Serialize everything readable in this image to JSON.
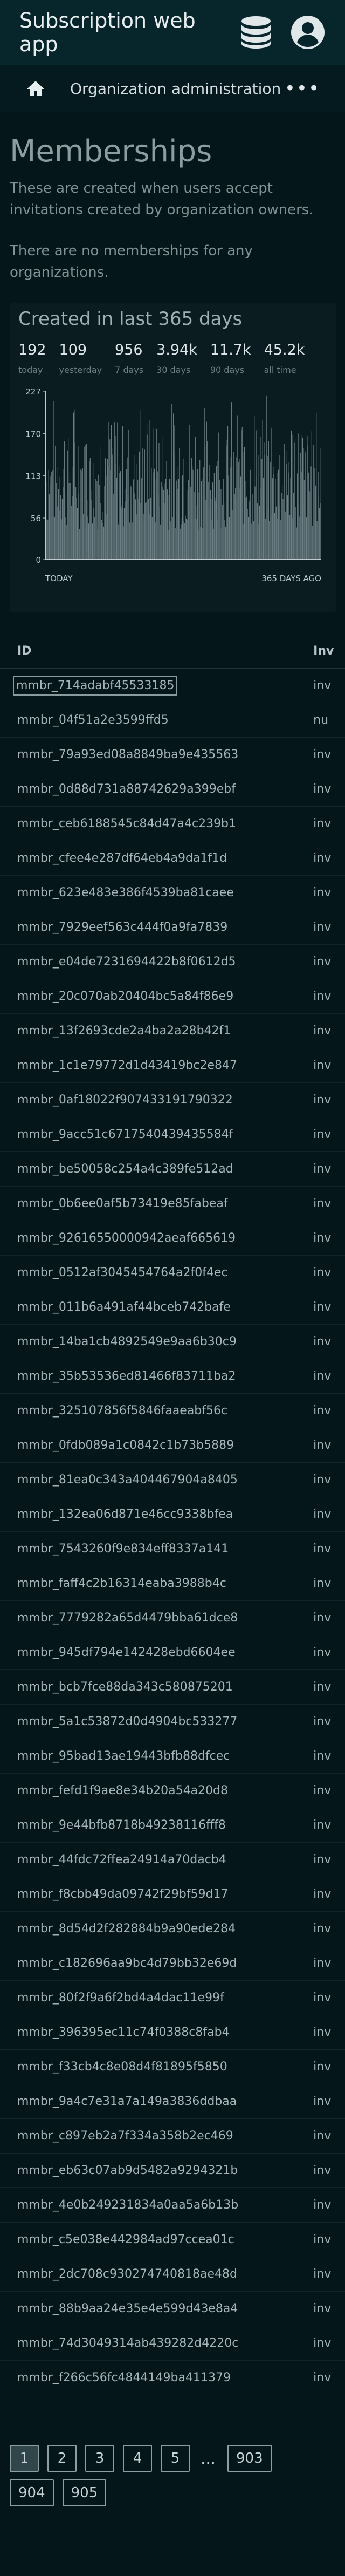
{
  "app": {
    "title": "Subscription web app"
  },
  "nav": {
    "title": "Organization administration",
    "more": "•••"
  },
  "page": {
    "title": "Memberships",
    "description": "These are created when users accept invitations created by organization owners.",
    "empty_text": "There are no memberships for any organizations."
  },
  "stats": {
    "title": "Created in last 365 days",
    "items": [
      {
        "value": "192",
        "label": "today"
      },
      {
        "value": "109",
        "label": "yesterday"
      },
      {
        "value": "956",
        "label": "7 days"
      },
      {
        "value": "3.94k",
        "label": "30 days"
      },
      {
        "value": "11.7k",
        "label": "90 days"
      },
      {
        "value": "45.2k",
        "label": "all time"
      }
    ]
  },
  "chart_data": {
    "type": "bar",
    "title": "",
    "xlabel": "",
    "ylabel": "",
    "ylim": [
      0,
      227
    ],
    "y_ticks": [
      "227",
      "170",
      "113",
      "56",
      "0"
    ],
    "x_tick_labels": [
      "TODAY",
      "365 DAYS AGO"
    ],
    "bar_count": 365,
    "bar_color": "#6d8085",
    "axis_color": "#c0ccce"
  },
  "table": {
    "columns": [
      "ID",
      "Inv"
    ],
    "rows": [
      [
        "mmbr_714adabf45533185",
        "inv"
      ],
      [
        "mmbr_04f51a2e3599ffd5",
        "nu"
      ],
      [
        "mmbr_79a93ed08a8849ba9e435563",
        "inv"
      ],
      [
        "mmbr_0d88d731a88742629a399ebf",
        "inv"
      ],
      [
        "mmbr_ceb6188545c84d47a4c239b1",
        "inv"
      ],
      [
        "mmbr_cfee4e287df64eb4a9da1f1d",
        "inv"
      ],
      [
        "mmbr_623e483e386f4539ba81caee",
        "inv"
      ],
      [
        "mmbr_7929eef563c444f0a9fa7839",
        "inv"
      ],
      [
        "mmbr_e04de7231694422b8f0612d5",
        "inv"
      ],
      [
        "mmbr_20c070ab20404bc5a84f86e9",
        "inv"
      ],
      [
        "mmbr_13f2693cde2a4ba2a28b42f1",
        "inv"
      ],
      [
        "mmbr_1c1e79772d1d43419bc2e847",
        "inv"
      ],
      [
        "mmbr_0af18022f907433191790322",
        "inv"
      ],
      [
        "mmbr_9acc51c6717540439435584f",
        "inv"
      ],
      [
        "mmbr_be50058c254a4c389fe512ad",
        "inv"
      ],
      [
        "mmbr_0b6ee0af5b73419e85fabeaf",
        "inv"
      ],
      [
        "mmbr_92616550000942aeaf665619",
        "inv"
      ],
      [
        "mmbr_0512af3045454764a2f0f4ec",
        "inv"
      ],
      [
        "mmbr_011b6a491af44bceb742bafe",
        "inv"
      ],
      [
        "mmbr_14ba1cb4892549e9aa6b30c9",
        "inv"
      ],
      [
        "mmbr_35b53536ed81466f83711ba2",
        "inv"
      ],
      [
        "mmbr_325107856f5846faaeabf56c",
        "inv"
      ],
      [
        "mmbr_0fdb089a1c0842c1b73b5889",
        "inv"
      ],
      [
        "mmbr_81ea0c343a404467904a8405",
        "inv"
      ],
      [
        "mmbr_132ea06d871e46cc9338bfea",
        "inv"
      ],
      [
        "mmbr_7543260f9e834eff8337a141",
        "inv"
      ],
      [
        "mmbr_faff4c2b16314eaba3988b4c",
        "inv"
      ],
      [
        "mmbr_7779282a65d4479bba61dce8",
        "inv"
      ],
      [
        "mmbr_945df794e142428ebd6604ee",
        "inv"
      ],
      [
        "mmbr_bcb7fce88da343c580875201",
        "inv"
      ],
      [
        "mmbr_5a1c53872d0d4904bc533277",
        "inv"
      ],
      [
        "mmbr_95bad13ae19443bfb88dfcec",
        "inv"
      ],
      [
        "mmbr_fefd1f9ae8e34b20a54a20d8",
        "inv"
      ],
      [
        "mmbr_9e44bfb8718b49238116fff8",
        "inv"
      ],
      [
        "mmbr_44fdc72ffea24914a70dacb4",
        "inv"
      ],
      [
        "mmbr_f8cbb49da09742f29bf59d17",
        "inv"
      ],
      [
        "mmbr_8d54d2f282884b9a90ede284",
        "inv"
      ],
      [
        "mmbr_c182696aa9bc4d79bb32e69d",
        "inv"
      ],
      [
        "mmbr_80f2f9a6f2bd4a4dac11e99f",
        "inv"
      ],
      [
        "mmbr_396395ec11c74f0388c8fab4",
        "inv"
      ],
      [
        "mmbr_f33cb4c8e08d4f81895f5850",
        "inv"
      ],
      [
        "mmbr_9a4c7e31a7a149a3836ddbaa",
        "inv"
      ],
      [
        "mmbr_c897eb2a7f334a358b2ec469",
        "inv"
      ],
      [
        "mmbr_eb63c07ab9d5482a9294321b",
        "inv"
      ],
      [
        "mmbr_4e0b249231834a0aa5a6b13b",
        "inv"
      ],
      [
        "mmbr_c5e038e442984ad97cceа01c",
        "inv"
      ],
      [
        "mmbr_2dc708c930274740818ae48d",
        "inv"
      ],
      [
        "mmbr_88b9aa24e35e4e599d43e8a4",
        "inv"
      ],
      [
        "mmbr_74d3049314ab439282d4220c",
        "inv"
      ],
      [
        "mmbr_f266c56fc4844149ba411379",
        "inv"
      ]
    ]
  },
  "pagination": {
    "pages": [
      "1",
      "2",
      "3",
      "4",
      "5"
    ],
    "ellipsis": "…",
    "tail_pages": [
      "903",
      "904",
      "905"
    ],
    "current": "1"
  },
  "colors": {
    "background": "#04161a",
    "topbar": "#06262b",
    "navbar": "#041a1e"
  }
}
